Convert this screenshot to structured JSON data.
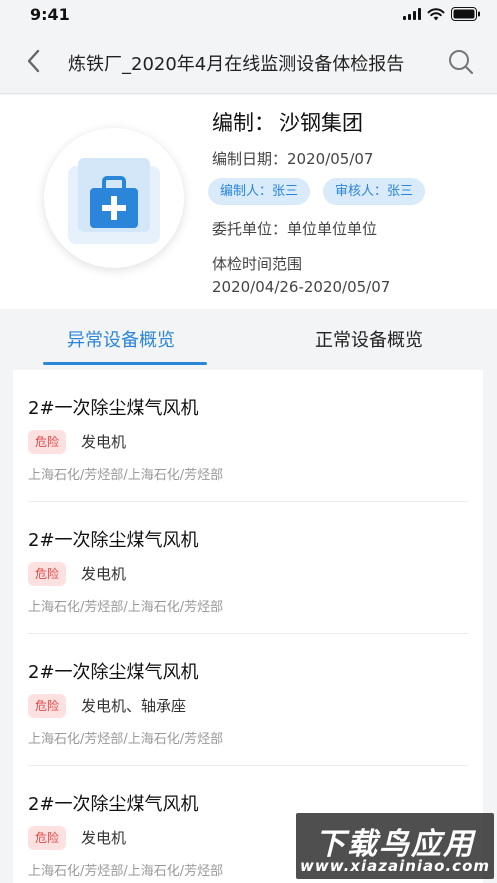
{
  "status_bar": {
    "time": "9:41"
  },
  "nav": {
    "title": "炼铁厂_2020年4月在线监测设备体检报告"
  },
  "header": {
    "org_label": "编制：",
    "org_value": "沙钢集团",
    "date_label": "编制日期：",
    "date_value": "2020/05/07",
    "editor_tag": "编制人：张三",
    "reviewer_tag": "审核人：张三",
    "client_label": "委托单位：",
    "client_value": "单位单位单位",
    "range_label": "体检时间范围",
    "range_value": "2020/04/26-2020/05/07"
  },
  "tabs": [
    {
      "label": "异常设备概览",
      "active": true
    },
    {
      "label": "正常设备概览",
      "active": false
    }
  ],
  "devices": [
    {
      "name": "2#一次除尘煤气风机",
      "level": "危险",
      "type": "发电机",
      "path": "上海石化/芳烃部/上海石化/芳烃部"
    },
    {
      "name": "2#一次除尘煤气风机",
      "level": "危险",
      "type": "发电机",
      "path": "上海石化/芳烃部/上海石化/芳烃部"
    },
    {
      "name": "2#一次除尘煤气风机",
      "level": "危险",
      "type": "发电机、轴承座",
      "path": "上海石化/芳烃部/上海石化/芳烃部"
    },
    {
      "name": "2#一次除尘煤气风机",
      "level": "危险",
      "type": "发电机",
      "path": "上海石化/芳烃部/上海石化/芳烃部"
    }
  ],
  "watermark": {
    "line1": "下载鸟应用",
    "line2": "www.xiazainiao.com"
  },
  "colors": {
    "accent": "#2b86d9",
    "danger": "#e04848",
    "danger_bg": "#fde1e1",
    "tag_bg": "#d9eafb"
  },
  "icons": {
    "back": "chevron-left-icon",
    "search": "search-icon",
    "logo": "medical-kit-icon"
  }
}
